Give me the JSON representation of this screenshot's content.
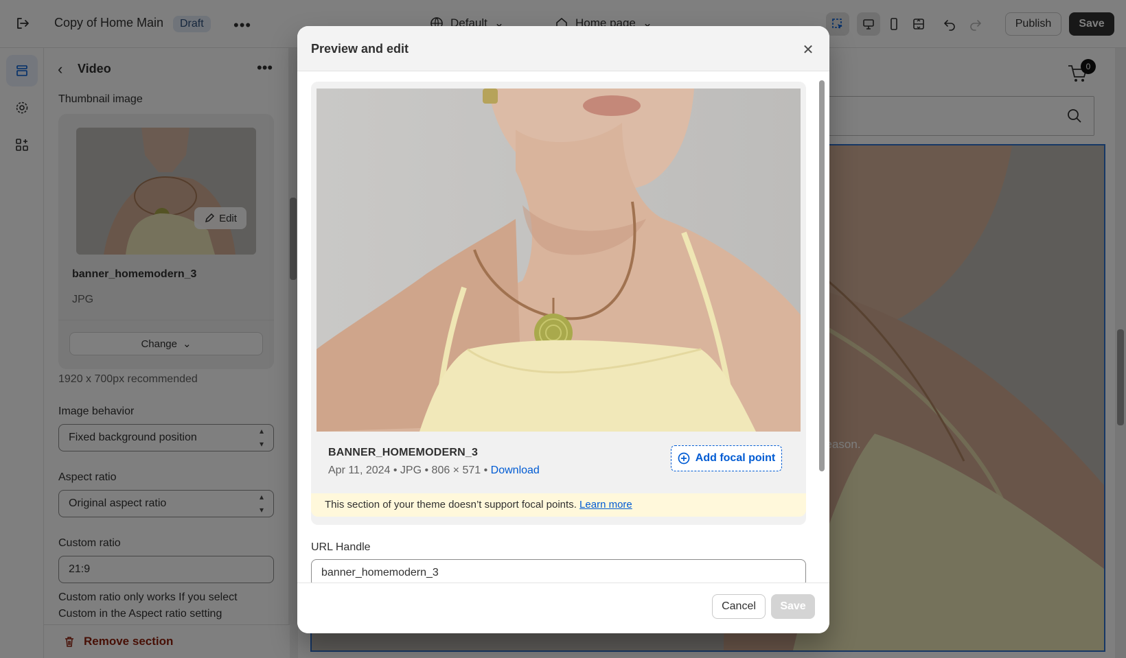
{
  "topbar": {
    "title": "Copy of Home Main",
    "status_badge": "Draft",
    "theme_selector": "Default",
    "page_selector": "Home page",
    "publish_label": "Publish",
    "save_label": "Save"
  },
  "panel": {
    "title": "Video",
    "thumbnail_label": "Thumbnail image",
    "edit_label": "Edit",
    "image_name": "banner_homemodern_3",
    "image_type": "JPG",
    "change_label": "Change",
    "recommended": "1920 x 700px recommended",
    "image_behavior_label": "Image behavior",
    "image_behavior_value": "Fixed background position",
    "aspect_ratio_label": "Aspect ratio",
    "aspect_ratio_value": "Original aspect ratio",
    "custom_ratio_label": "Custom ratio",
    "custom_ratio_value": "21:9",
    "custom_ratio_help": "Custom ratio only works If you select Custom in the Aspect ratio setting",
    "remove_label": "Remove section"
  },
  "storefront": {
    "cart_count": "0",
    "banner_text": "season."
  },
  "modal": {
    "title": "Preview and edit",
    "file_name": "BANNER_HOMEMODERN_3",
    "file_meta": "Apr 11, 2024 • JPG • 806 × 571 •",
    "download_label": "Download",
    "focal_button": "Add focal point",
    "focal_note": "This section of your theme doesn’t support focal points.",
    "learn_more": "Learn more",
    "url_label": "URL Handle",
    "url_value": "banner_homemodern_3",
    "cancel_label": "Cancel",
    "save_label": "Save"
  },
  "colors": {
    "accent": "#005bd3",
    "selection_border": "#2c6ecb",
    "danger": "#8e1f0b",
    "note_bg": "#fff8db"
  }
}
